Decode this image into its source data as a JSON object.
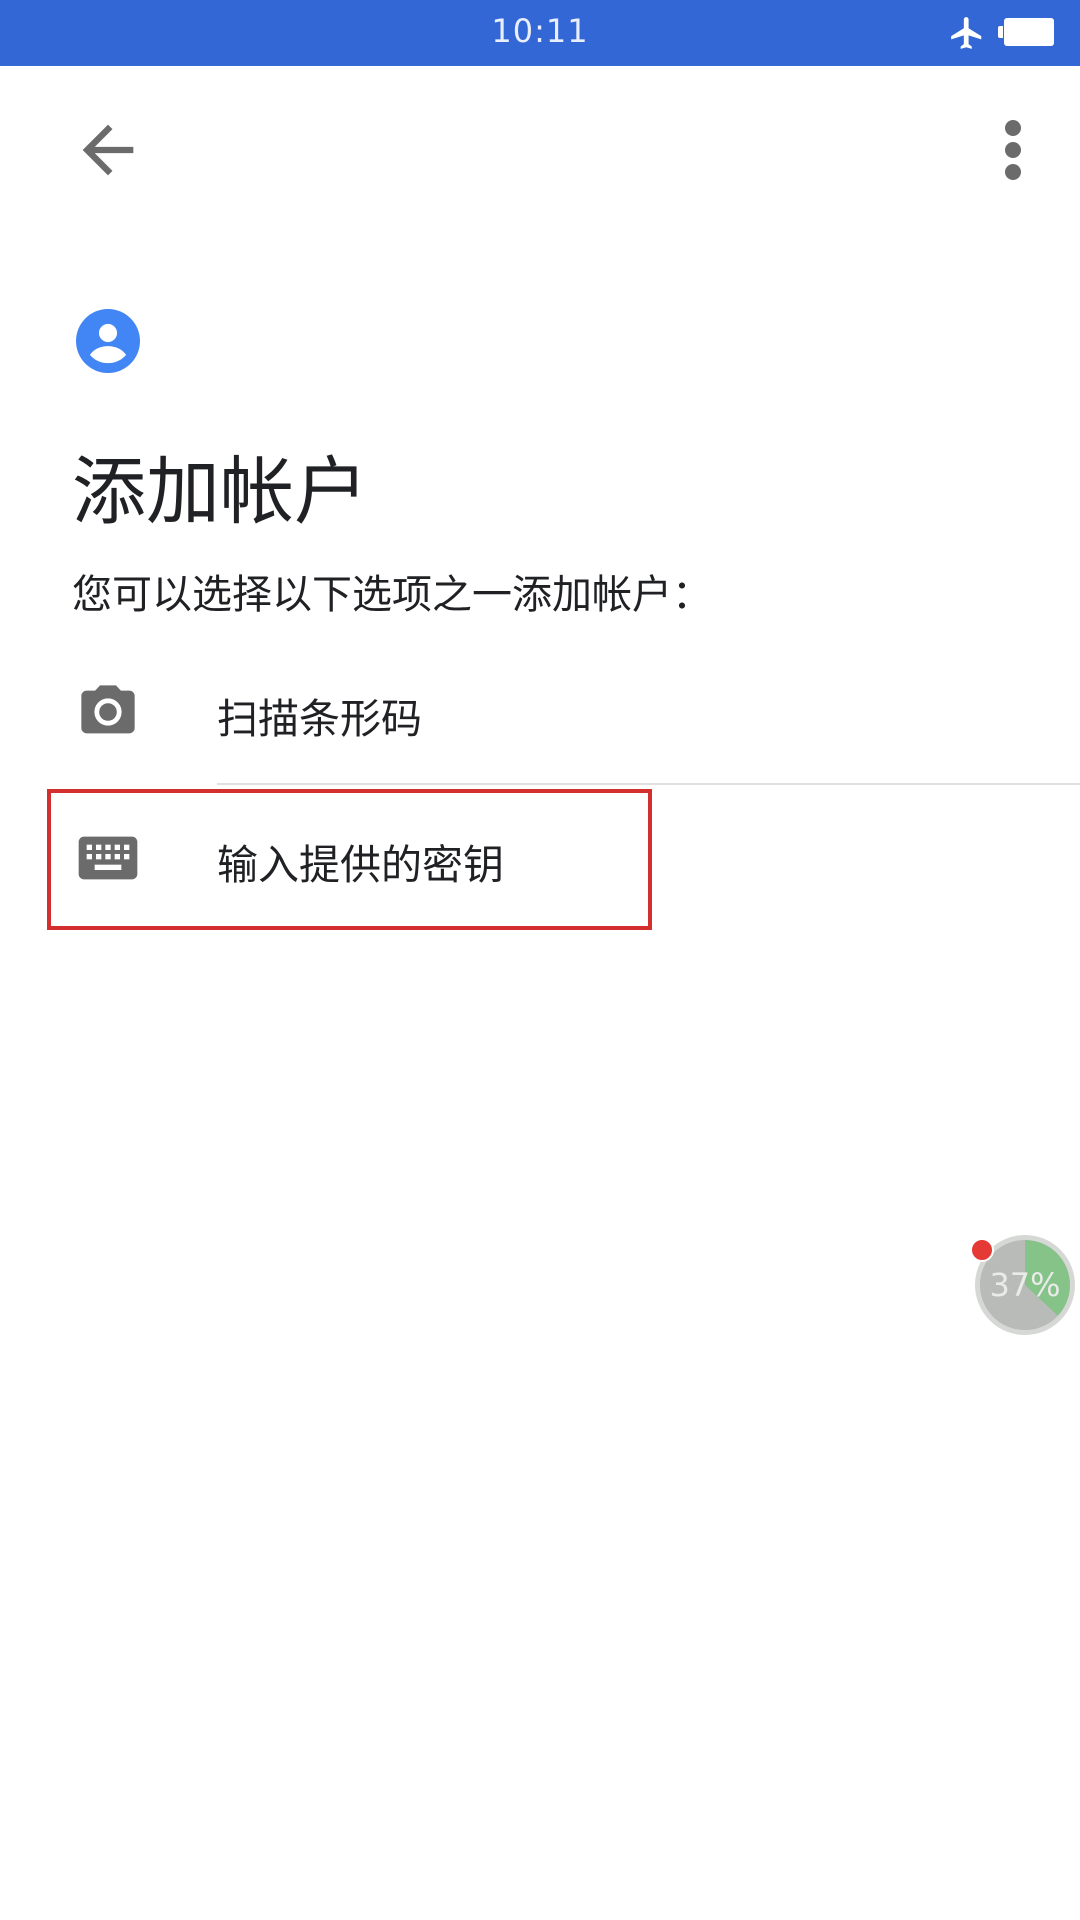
{
  "status_bar": {
    "time": "10:11",
    "icons": [
      "airplane-mode-icon",
      "battery-icon"
    ],
    "color": "#3367d6"
  },
  "toolbar": {
    "back_icon": "arrow-back-icon",
    "menu_icon": "more-vert-icon"
  },
  "header": {
    "icon": "account-circle-icon",
    "icon_color": "#4285f4",
    "title": "添加帐户",
    "subtitle": "您可以选择以下选项之一添加帐户："
  },
  "options": [
    {
      "icon": "camera-icon",
      "label": "扫描条形码"
    },
    {
      "icon": "keyboard-icon",
      "label": "输入提供的密钥",
      "highlighted": true
    }
  ],
  "floating_widget": {
    "value_text": "37%",
    "progress": 0.37,
    "accent": "#7bc47f",
    "badge_color": "#e53935"
  }
}
